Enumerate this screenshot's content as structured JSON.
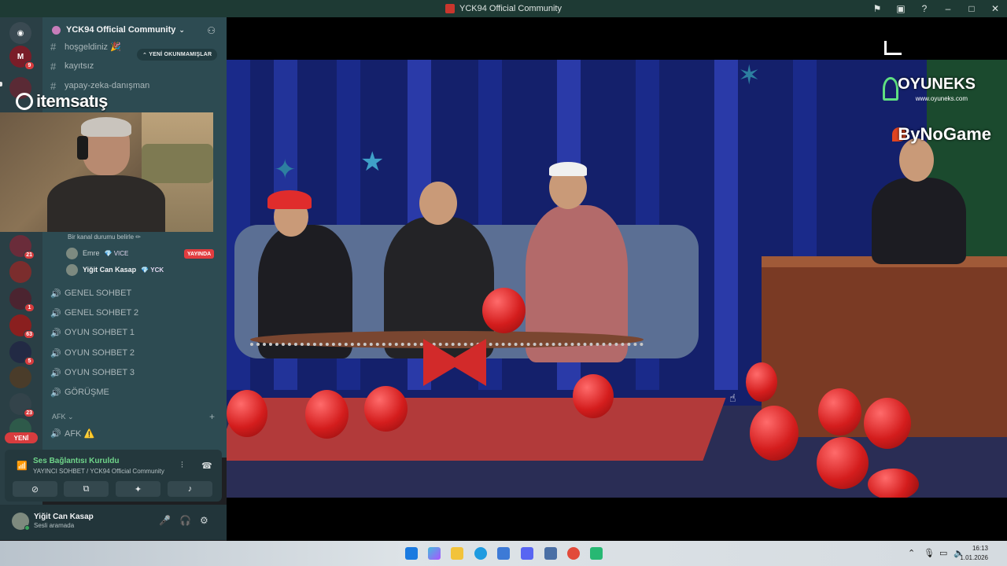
{
  "window": {
    "title": "YCK94 Official Community"
  },
  "server": {
    "name": "YCK94 Official Community"
  },
  "unread_pill": "YENİ OKUNMAMIŞLAR",
  "text_channels": [
    {
      "name": "hoşgeldiniz 🎉"
    },
    {
      "name": "kayıtsız"
    },
    {
      "name": "yapay-zeka-danışman"
    }
  ],
  "stream_overlay_brand": "itemsatış",
  "status_line": "Bir kanal durumu belirle ✏",
  "voice_users": [
    {
      "name": "Emre",
      "role": "💎 VICE",
      "live": "YAYINDA"
    },
    {
      "name": "Yiğit Can Kasap",
      "role": "💎 YCK"
    }
  ],
  "voice_channels": [
    {
      "name": "GENEL SOHBET"
    },
    {
      "name": "GENEL SOHBET 2"
    },
    {
      "name": "OYUN SOHBET 1"
    },
    {
      "name": "OYUN SOHBET 2"
    },
    {
      "name": "OYUN SOHBET 3"
    },
    {
      "name": "GÖRÜŞME"
    }
  ],
  "category_afk": "AFK ⌄",
  "afk_channel": "AFK ⚠️",
  "rail": {
    "badges": [
      "9",
      "21",
      "1",
      "63",
      "5",
      "23"
    ],
    "new_pill": "YENİ"
  },
  "voice_panel": {
    "status": "Ses Bağlantısı Kuruldu",
    "sub": "YAYINCI SOHBET / YCK94 Official Community"
  },
  "user": {
    "name": "Yiğit Can Kasap",
    "sub": "Sesli aramada"
  },
  "video": {
    "logo_top": "OYUNEKS",
    "logo_url": "www.oyuneks.com",
    "logo_bottom": "ByNoGame"
  },
  "clock": {
    "time": "16:13",
    "date": "1.01.2026"
  },
  "colors": {
    "sidebar": "#2d4b52",
    "rail": "#2a3f45",
    "live": "#e23c3f",
    "connected": "#6fd58a"
  }
}
